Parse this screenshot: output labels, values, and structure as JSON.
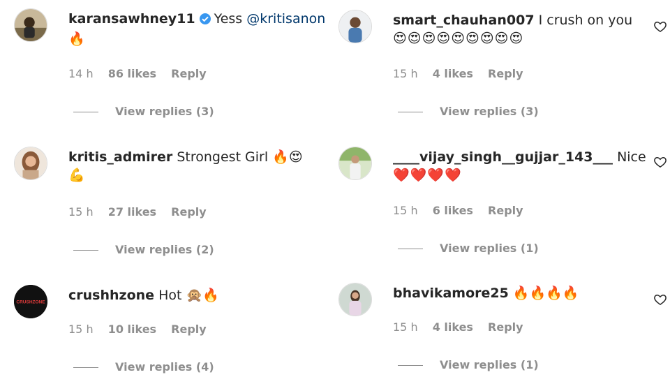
{
  "comments": [
    {
      "username": "karansawhney11",
      "verified": true,
      "text": "Yess ",
      "mention": "@kritisanon",
      "emojis": "🔥",
      "time": "14 h",
      "likes": "86 likes",
      "reply": "Reply",
      "view_replies": "View replies (3)"
    },
    {
      "username": "smart_chauhan007",
      "text": "I crush on you",
      "emojis": "😍😍😍😍😍😍😍😍😍",
      "time": "15 h",
      "likes": "4 likes",
      "reply": "Reply",
      "view_replies": "View replies (3)"
    },
    {
      "username": "kritis_admirer",
      "text": "Strongest Girl 🔥😍",
      "emojis": "💪",
      "time": "15 h",
      "likes": "27 likes",
      "reply": "Reply",
      "view_replies": "View replies (2)"
    },
    {
      "username": "____vijay_singh__gujjar_143___",
      "text": "Nice",
      "emojis": "❤️❤️❤️❤️",
      "time": "15 h",
      "likes": "6 likes",
      "reply": "Reply",
      "view_replies": "View replies (1)"
    },
    {
      "username": "crushhzone",
      "text": "Hot 🙊🔥",
      "avatar_text": "CRUSHZONE",
      "time": "15 h",
      "likes": "10 likes",
      "reply": "Reply",
      "view_replies": "View replies (4)"
    },
    {
      "username": "bhavikamore25",
      "text": "🔥🔥🔥🔥",
      "time": "15 h",
      "likes": "4 likes",
      "reply": "Reply",
      "view_replies": "View replies (1)"
    }
  ],
  "colors": {
    "text": "#262626",
    "meta": "#8e8e8e",
    "mention": "#00376b",
    "verified": "#3897f0"
  },
  "icons": {
    "like": "heart-outline-icon",
    "verified": "verified-badge-icon"
  }
}
